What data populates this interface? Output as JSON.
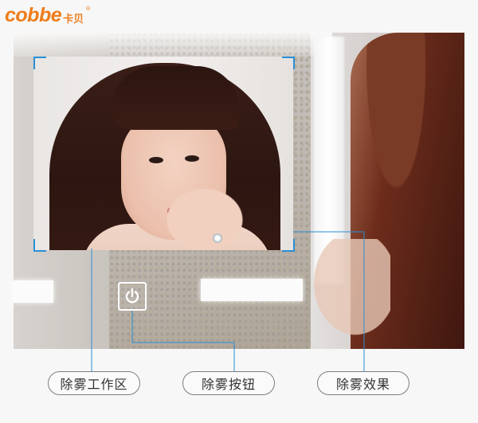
{
  "brand": {
    "name": "cobbe",
    "name_cn": "卡贝",
    "registered_mark": "®",
    "color": "#ee7d1a"
  },
  "accent_color": "#2a8fd6",
  "icons": {
    "power": "power-icon"
  },
  "labels": {
    "work_area": "除雾工作区",
    "button": "除雾按钮",
    "effect": "除雾效果"
  }
}
